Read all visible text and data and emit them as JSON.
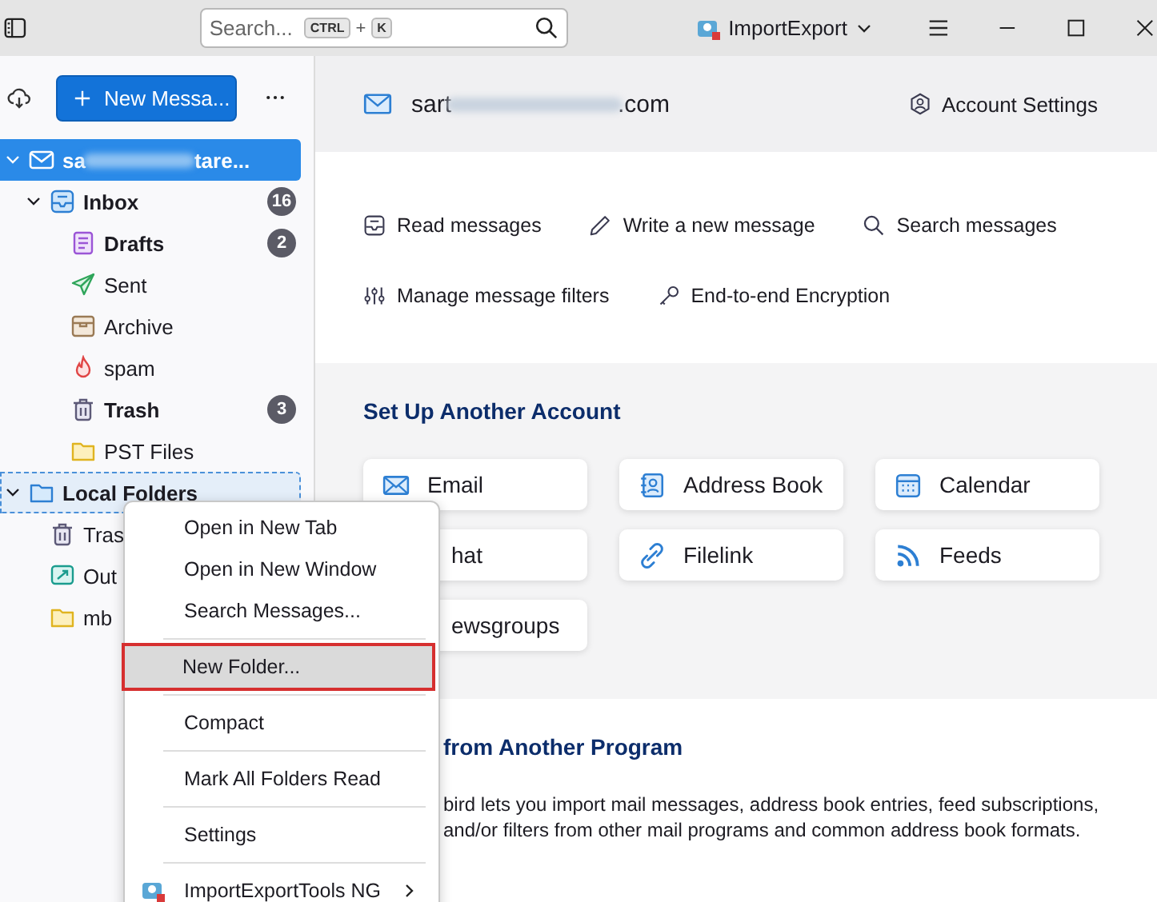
{
  "titlebar": {
    "search": {
      "placeholder": "Search...",
      "shortcut": [
        "CTRL",
        "+",
        "K"
      ]
    },
    "addon": "ImportExport"
  },
  "sidebar": {
    "new_message": "New Messa...",
    "folders": [
      {
        "kind": "account",
        "label_start": "sa",
        "label_end": "tare...",
        "selected": true,
        "focused": false,
        "expanded": true,
        "unread": true,
        "children": [
          {
            "kind": "inbox",
            "label": "Inbox",
            "count": "16",
            "unread": true,
            "selected": false,
            "focused": false,
            "expanded": true,
            "children": [
              {
                "kind": "drafts",
                "label": "Drafts",
                "count": "2",
                "unread": true,
                "selected": false,
                "focused": false
              },
              {
                "kind": "sent",
                "label": "Sent",
                "unread": false,
                "selected": false,
                "focused": false
              },
              {
                "kind": "archive",
                "label": "Archive",
                "unread": false,
                "selected": false,
                "focused": false
              },
              {
                "kind": "spam",
                "label": "spam",
                "unread": false,
                "selected": false,
                "focused": false
              },
              {
                "kind": "trash",
                "label": "Trash",
                "count": "3",
                "unread": true,
                "selected": false,
                "focused": false
              },
              {
                "kind": "folder",
                "label": "PST Files",
                "unread": false,
                "selected": false,
                "focused": false
              }
            ]
          }
        ]
      },
      {
        "kind": "local",
        "label": "Local Folders",
        "unread": true,
        "selected": false,
        "focused": true,
        "expanded": true,
        "children": [
          {
            "kind": "trash",
            "label": "Tras",
            "unread": false,
            "selected": false,
            "focused": false
          },
          {
            "kind": "outbox",
            "label": "Out",
            "unread": false,
            "selected": false,
            "focused": false
          },
          {
            "kind": "folder",
            "label": "mb",
            "unread": false,
            "selected": false,
            "focused": false
          }
        ]
      }
    ]
  },
  "account_header": {
    "email_start": "sart",
    "email_end": ".com",
    "settings": "Account Settings"
  },
  "actions": [
    {
      "kind": "read",
      "label": "Read messages"
    },
    {
      "kind": "write",
      "label": "Write a new message"
    },
    {
      "kind": "search",
      "label": "Search messages"
    },
    {
      "kind": "filters",
      "label": "Manage message filters"
    },
    {
      "kind": "encryption",
      "label": "End-to-end Encryption"
    }
  ],
  "setup": {
    "title": "Set Up Another Account",
    "cards": [
      {
        "kind": "email",
        "label": "Email"
      },
      {
        "kind": "address_book",
        "label": "Address Book"
      },
      {
        "kind": "calendar",
        "label": "Calendar"
      },
      {
        "kind": "hidden",
        "label": "hat"
      },
      {
        "kind": "filelink",
        "label": "Filelink"
      },
      {
        "kind": "feeds",
        "label": "Feeds"
      },
      {
        "kind": "hidden",
        "label": "ewsgroups"
      }
    ]
  },
  "import": {
    "title": "from Another Program",
    "lines": [
      "bird lets you import mail messages, address book entries, feed subscriptions,",
      "and/or filters from other mail programs and common address book formats."
    ]
  },
  "context_menu": [
    {
      "kind": "item",
      "label": "Open in New Tab",
      "highlighted": false
    },
    {
      "kind": "item",
      "label": "Open in New Window",
      "highlighted": false
    },
    {
      "kind": "item",
      "label": "Search Messages...",
      "highlighted": false
    },
    {
      "kind": "separator"
    },
    {
      "kind": "item",
      "label": "New Folder...",
      "highlighted": true
    },
    {
      "kind": "separator"
    },
    {
      "kind": "item",
      "label": "Compact",
      "highlighted": false
    },
    {
      "kind": "separator"
    },
    {
      "kind": "item",
      "label": "Mark All Folders Read",
      "highlighted": false
    },
    {
      "kind": "separator"
    },
    {
      "kind": "item",
      "label": "Settings",
      "highlighted": false
    },
    {
      "kind": "separator"
    },
    {
      "kind": "submenu",
      "label": "ImportExportTools NG",
      "highlighted": false
    }
  ]
}
